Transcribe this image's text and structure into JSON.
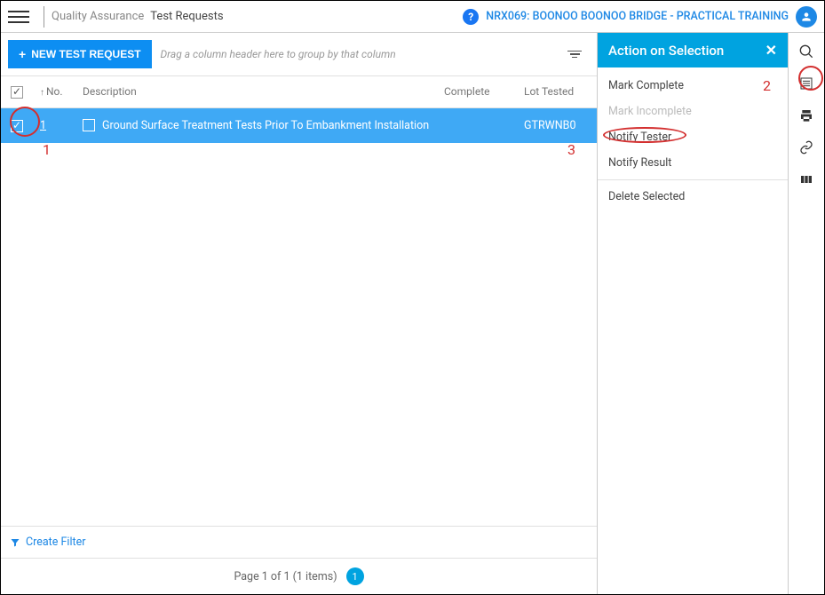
{
  "header": {
    "breadcrumb_section": "Quality Assurance",
    "breadcrumb_page": "Test Requests",
    "project_link": "NRX069: BOONOO BOONOO BRIDGE - PRACTICAL TRAINING"
  },
  "toolbar": {
    "new_label": "NEW TEST REQUEST",
    "group_hint": "Drag a column header here to group by that column"
  },
  "columns": {
    "no": "No.",
    "description": "Description",
    "complete": "Complete",
    "lot_tested": "Lot Tested"
  },
  "rows": [
    {
      "num": "1",
      "description": "Ground Surface Treatment Tests Prior To Embankment Installation",
      "complete": "",
      "lot_tested": "GTRWNB0"
    }
  ],
  "footer": {
    "create_filter": "Create Filter",
    "pager_text": "Page 1 of 1 (1 items)",
    "page_current": "1"
  },
  "panel": {
    "title": "Action on Selection",
    "actions": {
      "mark_complete": "Mark Complete",
      "mark_incomplete": "Mark Incomplete",
      "notify_tester": "Notify Tester",
      "notify_result": "Notify Result",
      "delete_selected": "Delete Selected"
    }
  },
  "annotations": {
    "a1": "1",
    "a2": "2",
    "a3": "3"
  }
}
